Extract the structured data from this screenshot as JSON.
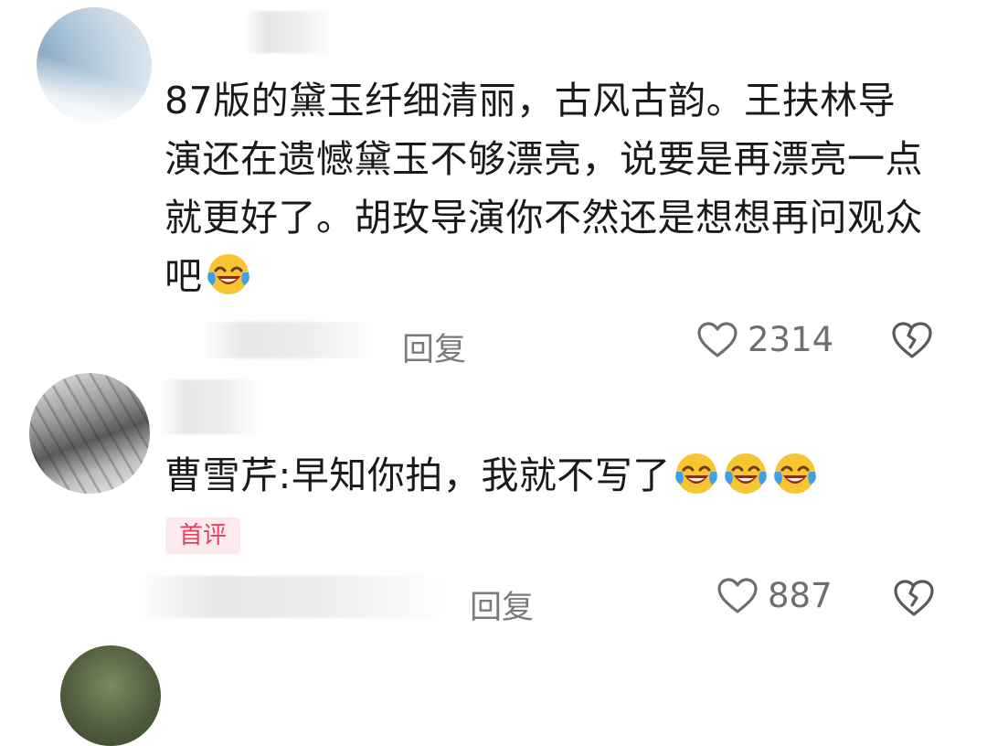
{
  "comments": [
    {
      "text": "87版的黛玉纤细清丽，古风古韵。王扶林导演还在遗憾黛玉不够漂亮，说要是再漂亮一点就更好了。胡玫导演你不然还是想想再问观众吧",
      "emoji": "laughing-crying-emoji",
      "reply_label": "回复",
      "like_count": "2314"
    },
    {
      "text": "曹雪芹:早知你拍，我就不写了",
      "emoji": "laughing-crying-emoji",
      "badge": "首评",
      "reply_label": "回复",
      "like_count": "887"
    }
  ],
  "colors": {
    "badge_bg": "#fde9ee",
    "badge_text": "#e0405f",
    "meta_gray": "#7b7b7b"
  }
}
